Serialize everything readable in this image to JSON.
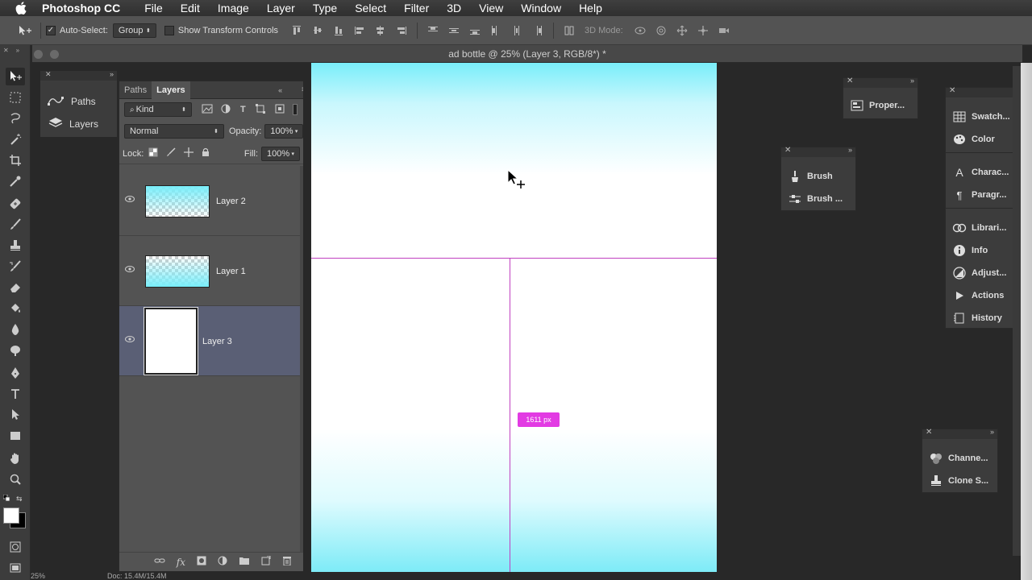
{
  "menubar": {
    "app_name": "Photoshop CC",
    "items": [
      "File",
      "Edit",
      "Image",
      "Layer",
      "Type",
      "Select",
      "Filter",
      "3D",
      "View",
      "Window",
      "Help"
    ]
  },
  "options": {
    "auto_select_label": "Auto-Select:",
    "auto_select_value": "Group",
    "transform_label": "Show Transform Controls",
    "mode_label": "3D Mode:"
  },
  "document": {
    "title": "ad bottle @ 25% (Layer 3, RGB/8*) *"
  },
  "dock": {
    "items": [
      {
        "label": "Paths",
        "icon": "paths-icon"
      },
      {
        "label": "Layers",
        "icon": "layers-icon"
      }
    ]
  },
  "layers_panel": {
    "tabs": [
      "Paths",
      "Layers"
    ],
    "filter_kind": "Kind",
    "blend_mode": "Normal",
    "opacity_label": "Opacity:",
    "opacity_value": "100%",
    "lock_label": "Lock:",
    "fill_label": "Fill:",
    "fill_value": "100%",
    "layers": [
      {
        "name": "Layer 2",
        "selected": false
      },
      {
        "name": "Layer 1",
        "selected": false
      },
      {
        "name": "Layer 3",
        "selected": true
      }
    ]
  },
  "canvas": {
    "measure_label": "1611 px"
  },
  "panels": {
    "properties": {
      "items": [
        "Proper..."
      ]
    },
    "brush": {
      "items": [
        "Brush",
        "Brush ..."
      ]
    },
    "right_stack": {
      "items": [
        "Swatch...",
        "Color",
        "Charac...",
        "Paragr...",
        "Librari...",
        "Info",
        "Adjust...",
        "Actions",
        "History"
      ]
    },
    "channels": {
      "items": [
        "Channe...",
        "Clone S..."
      ]
    }
  },
  "status": {
    "zoom": "25%",
    "doc": "Doc: 15.4M/15.4M"
  },
  "colors": {
    "guide": "#c040c0",
    "measure_badge": "#e23be3",
    "canvas_cyan": "#79eefa",
    "selected_layer": "#5a5f75"
  }
}
